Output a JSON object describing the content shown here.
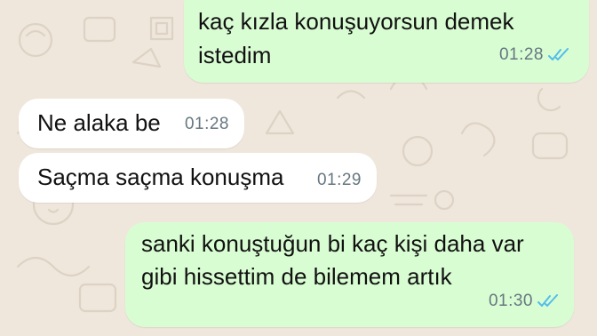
{
  "colors": {
    "wallpaper": "#efe7dc",
    "outgoing_bubble": "#d9fdd3",
    "incoming_bubble": "#ffffff",
    "read_ticks": "#53bdeb",
    "timestamp": "#667781"
  },
  "messages": [
    {
      "direction": "outgoing",
      "lines": [
        "kaç kızla konuşuyorsun demek",
        "istedim"
      ],
      "time": "01:28",
      "status_icon": "double-check-read-icon"
    },
    {
      "direction": "incoming",
      "lines": [
        "Ne alaka be"
      ],
      "time": "01:28"
    },
    {
      "direction": "incoming",
      "lines": [
        "Saçma saçma konuşma"
      ],
      "time": "01:29"
    },
    {
      "direction": "outgoing",
      "lines": [
        "sanki konuştuğun bi kaç kişi daha var",
        "gibi hissettim de bilemem artık"
      ],
      "time": "01:30",
      "status_icon": "double-check-read-icon"
    }
  ]
}
